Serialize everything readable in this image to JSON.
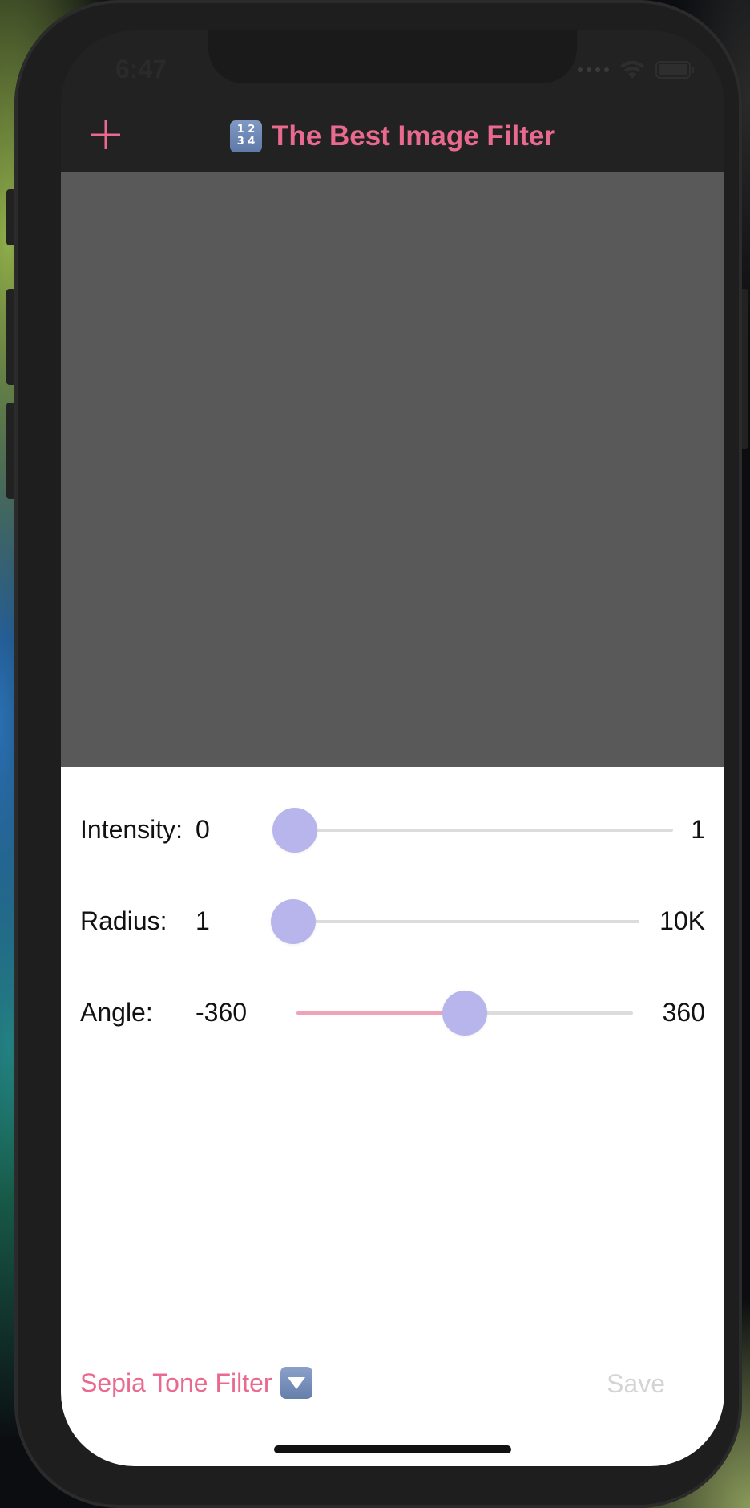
{
  "status_bar": {
    "time": "6:47"
  },
  "nav": {
    "title": "The Best Image Filter",
    "title_icon": "input-numbers-icon",
    "add_icon": "plus-icon"
  },
  "controls": {
    "sliders": [
      {
        "label": "Intensity:",
        "min": "0",
        "max": "1",
        "value_fraction": 0.0
      },
      {
        "label": "Radius:",
        "min": "1",
        "max": "10K",
        "value_fraction": 0.0
      },
      {
        "label": "Angle:",
        "min": "-360",
        "max": "360",
        "value_fraction": 0.5
      }
    ]
  },
  "footer": {
    "filter_label": "Sepia Tone Filter",
    "filter_icon": "chevron-down-square-icon",
    "save_label": "Save"
  },
  "colors": {
    "accent": "#ea6a8f",
    "thumb": "#b7b5ec",
    "track_fill": "#f0a3b8",
    "preview_background": "#595959",
    "disabled_text": "#d4d4d4"
  }
}
